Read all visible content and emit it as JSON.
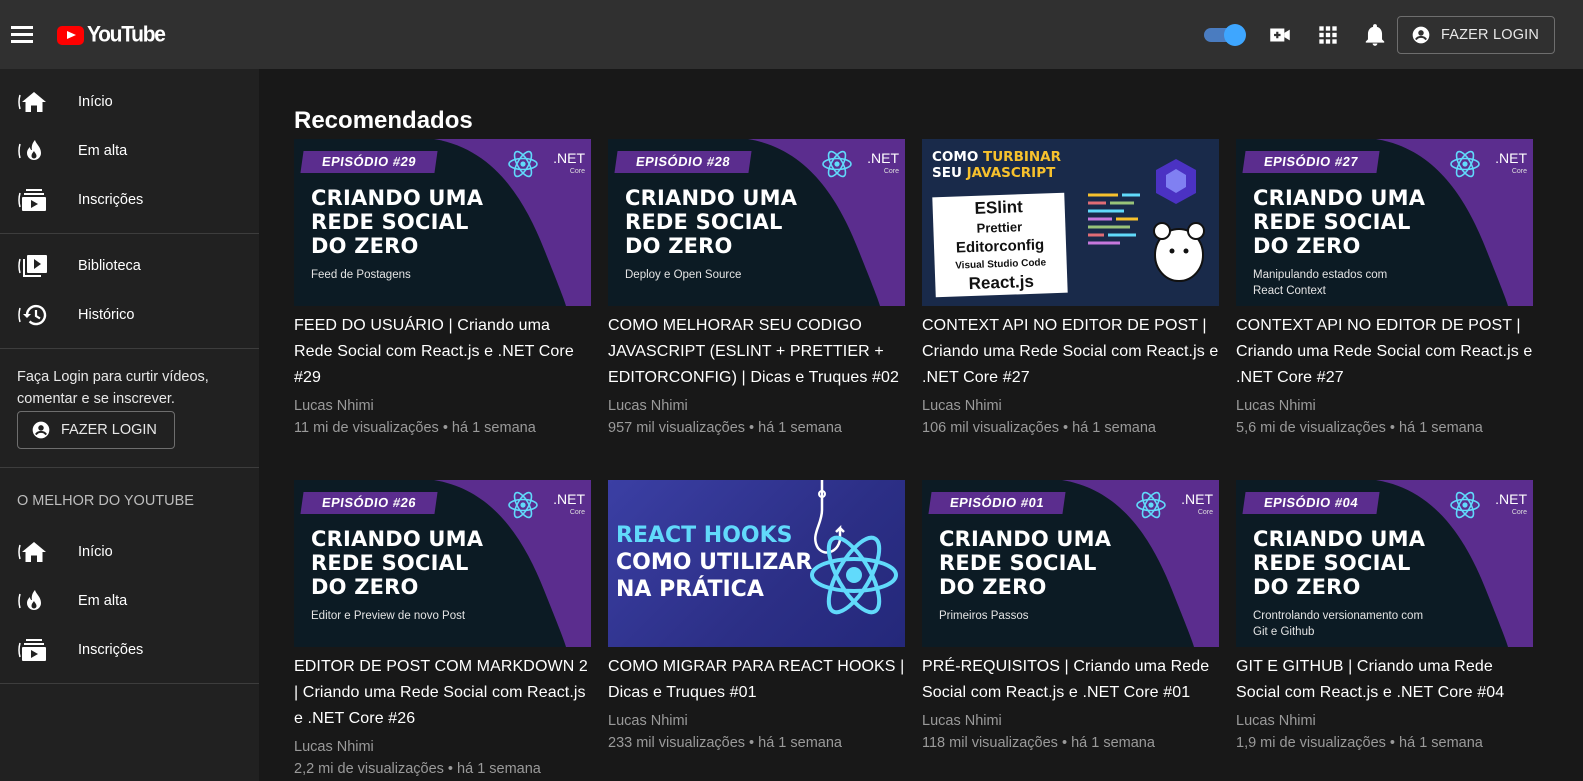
{
  "header": {
    "logo_text": "YouTube",
    "login_label": "FAZER LOGIN"
  },
  "sidebar": {
    "primary": [
      {
        "label": "Início",
        "icon": "home-icon"
      },
      {
        "label": "Em alta",
        "icon": "trending-icon"
      },
      {
        "label": "Inscrições",
        "icon": "subscriptions-icon"
      }
    ],
    "library": [
      {
        "label": "Biblioteca",
        "icon": "library-icon"
      },
      {
        "label": "Histórico",
        "icon": "history-icon"
      }
    ],
    "login_prompt": "Faça Login para curtir vídeos, comentar e se inscrever.",
    "login_label": "FAZER LOGIN",
    "best_of_title": "O MELHOR DO YOUTUBE",
    "best_of": [
      {
        "label": "Início",
        "icon": "home-icon"
      },
      {
        "label": "Em alta",
        "icon": "trending-icon"
      },
      {
        "label": "Inscrições",
        "icon": "subscriptions-icon"
      }
    ]
  },
  "main": {
    "title": "Recomendados",
    "videos": [
      {
        "thumb": {
          "badge": "EPISÓDIO #29",
          "headline": [
            "CRIANDO UMA",
            "REDE SOCIAL",
            "DO ZERO"
          ],
          "sub": [
            "Feed de Postagens"
          ],
          "net": ".NET",
          "net_sub": "Core"
        },
        "title": "FEED DO USUÁRIO | Criando uma Rede Social com React.js e .NET Core #29",
        "channel": "Lucas Nhimi",
        "meta": "11 mi de visualizações • há 1 semana"
      },
      {
        "thumb": {
          "badge": "EPISÓDIO #28",
          "headline": [
            "CRIANDO UMA",
            "REDE SOCIAL",
            "DO ZERO"
          ],
          "sub": [
            "Deploy e Open Source"
          ],
          "net": ".NET",
          "net_sub": "Core"
        },
        "title": "COMO MELHORAR SEU CODIGO JAVASCRIPT (ESLINT + PRETTIER + EDITORCONFIG) | Dicas e Truques #02",
        "channel": "Lucas Nhimi",
        "meta": "957 mil visualizações • há 1 semana"
      },
      {
        "thumb": {
          "line1a": "COMO ",
          "line1b": "TURBINAR",
          "line2a": "SEU ",
          "line2b": "JAVASCRIPT",
          "tags": [
            "ESlint",
            "Prettier",
            "Editorconfig",
            "Visual Studio Code",
            "React.js"
          ]
        },
        "title": "CONTEXT API NO EDITOR DE POST | Criando uma Rede Social com React.js e .NET Core #27",
        "channel": "Lucas Nhimi",
        "meta": "106 mil visualizações • há 1 semana"
      },
      {
        "thumb": {
          "badge": "EPISÓDIO #27",
          "headline": [
            "CRIANDO UMA",
            "REDE SOCIAL",
            "DO ZERO"
          ],
          "sub": [
            "Manipulando estados com",
            "React Context"
          ],
          "net": ".NET",
          "net_sub": "Core"
        },
        "title": "CONTEXT API NO EDITOR DE POST | Criando uma Rede Social com React.js e .NET Core #27",
        "channel": "Lucas Nhimi",
        "meta": "5,6 mi de visualizações • há 1 semana"
      },
      {
        "thumb": {
          "badge": "EPISÓDIO #26",
          "headline": [
            "CRIANDO UMA",
            "REDE SOCIAL",
            "DO ZERO"
          ],
          "sub": [
            "Editor e Preview de novo Post"
          ],
          "net": ".NET",
          "net_sub": "Core"
        },
        "title": "EDITOR DE POST COM MARKDOWN 2 | Criando uma Rede Social com React.js e .NET Core #26",
        "channel": "Lucas Nhimi",
        "meta": "2,2 mi de visualizações • há 1 semana"
      },
      {
        "thumb": {
          "hooks": [
            "REACT HOOKS",
            "COMO UTILIZAR",
            "NA PRÁTICA"
          ]
        },
        "title": "COMO MIGRAR PARA REACT HOOKS | Dicas e Truques #01",
        "channel": "Lucas Nhimi",
        "meta": "233 mil visualizações • há 1 semana"
      },
      {
        "thumb": {
          "badge": "EPISÓDIO #01",
          "headline": [
            "CRIANDO UMA",
            "REDE SOCIAL",
            "DO ZERO"
          ],
          "sub": [
            "Primeiros Passos"
          ],
          "net": ".NET",
          "net_sub": "Core"
        },
        "title": "PRÉ-REQUISITOS | Criando uma Rede Social com React.js e .NET Core #01",
        "channel": "Lucas Nhimi",
        "meta": "118 mil visualizações • há 1 semana"
      },
      {
        "thumb": {
          "badge": "EPISÓDIO #04",
          "headline": [
            "CRIANDO UMA",
            "REDE SOCIAL",
            "DO ZERO"
          ],
          "sub": [
            "Crontrolando versionamento com",
            "Git e Github"
          ],
          "net": ".NET",
          "net_sub": "Core"
        },
        "title": "GIT E GITHUB | Criando uma Rede Social com React.js e .NET Core #04",
        "channel": "Lucas Nhimi",
        "meta": "1,9 mi de visualizações • há 1 semana"
      }
    ]
  },
  "colors": {
    "topbar": "#303030",
    "sidebar": "#212121",
    "background": "#181818",
    "brand_red": "#ff0000",
    "accent_blue": "#3ea6ff",
    "thumb_purple": "#5b2d8e"
  }
}
